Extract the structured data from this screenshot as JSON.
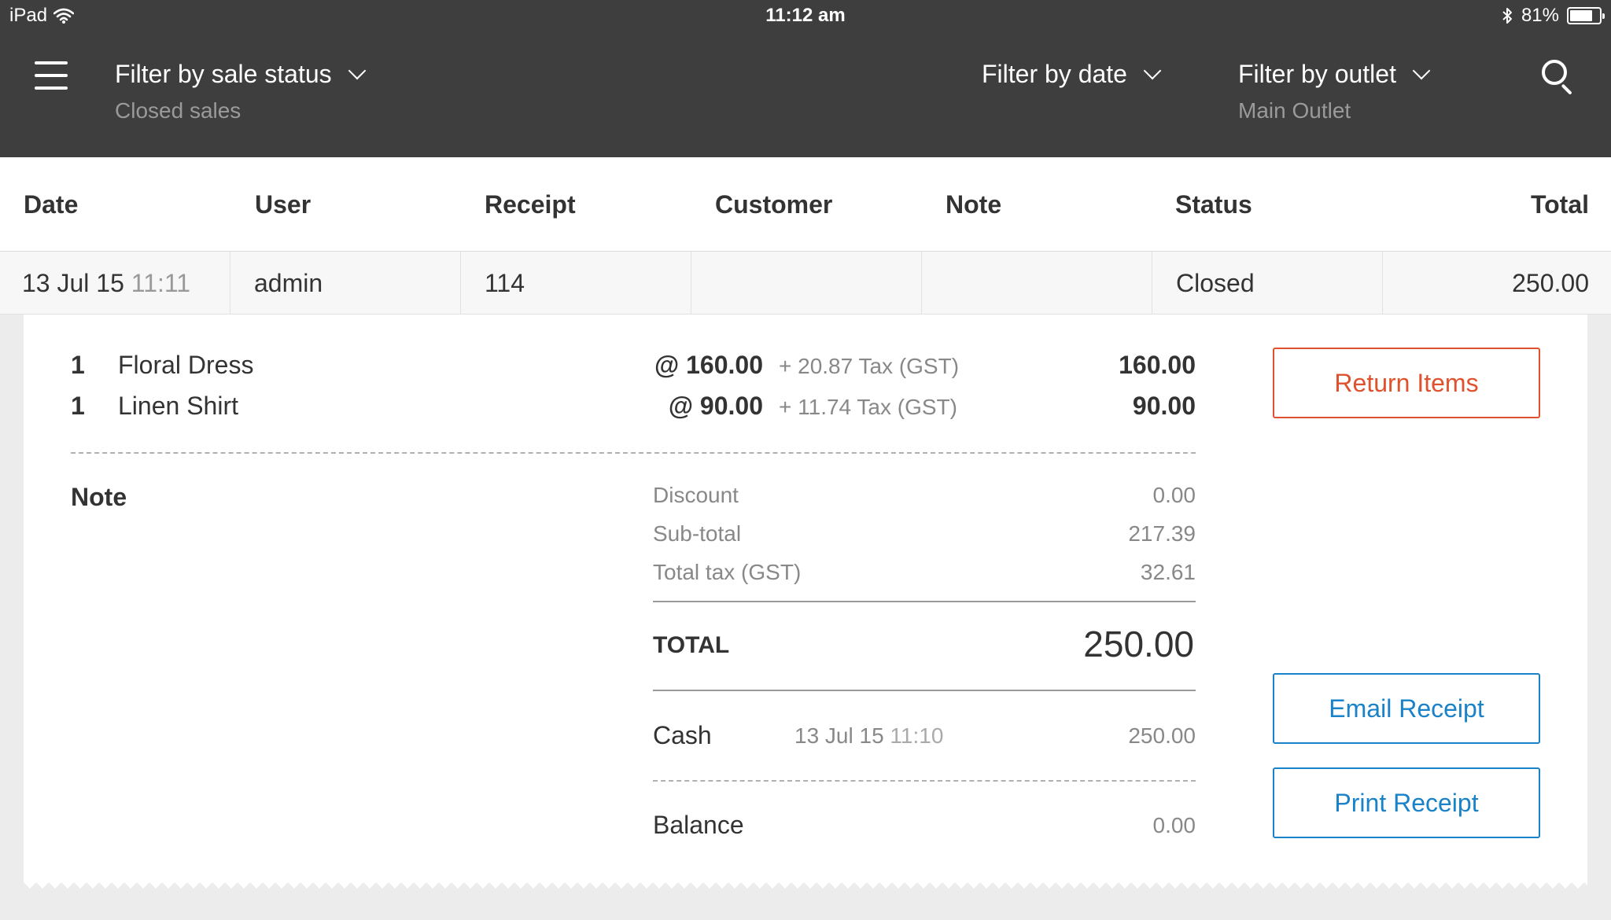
{
  "status_bar": {
    "device": "iPad",
    "time": "11:12 am",
    "battery": "81%",
    "battery_level": 0.81
  },
  "header": {
    "menu_icon": "hamburger-menu-icon",
    "filters": [
      {
        "label": "Filter by sale status",
        "value": "Closed sales"
      },
      {
        "label": "Filter by date",
        "value": ""
      },
      {
        "label": "Filter by outlet",
        "value": "Main Outlet"
      }
    ],
    "search_icon": "search-icon"
  },
  "table": {
    "columns": [
      "Date",
      "User",
      "Receipt",
      "Customer",
      "Note",
      "Status",
      "Total"
    ],
    "row": {
      "date": "13 Jul 15",
      "time": "11:11",
      "user": "admin",
      "receipt": "114",
      "customer": "",
      "note": "",
      "status": "Closed",
      "total": "250.00"
    }
  },
  "receipt": {
    "items": [
      {
        "qty": "1",
        "name": "Floral Dress",
        "unit_price": "@ 160.00",
        "tax": "+ 20.87 Tax (GST)",
        "total": "160.00"
      },
      {
        "qty": "1",
        "name": "Linen Shirt",
        "unit_price": "@ 90.00",
        "tax": "+ 11.74 Tax (GST)",
        "total": "90.00"
      }
    ],
    "note_label": "Note",
    "summary": {
      "discount_label": "Discount",
      "discount": "0.00",
      "subtotal_label": "Sub-total",
      "subtotal": "217.39",
      "tax_label": "Total tax (GST)",
      "tax": "32.61"
    },
    "total_label": "TOTAL",
    "total": "250.00",
    "payment": {
      "method": "Cash",
      "date": "13 Jul 15",
      "time": "11:10",
      "amount": "250.00"
    },
    "balance_label": "Balance",
    "balance": "0.00"
  },
  "actions": {
    "return_items": "Return Items",
    "email_receipt": "Email Receipt",
    "print_receipt": "Print Receipt"
  },
  "colors": {
    "header_bg": "#3e3e3e",
    "return_accent": "#e0522d",
    "action_accent": "#1a82c8"
  }
}
